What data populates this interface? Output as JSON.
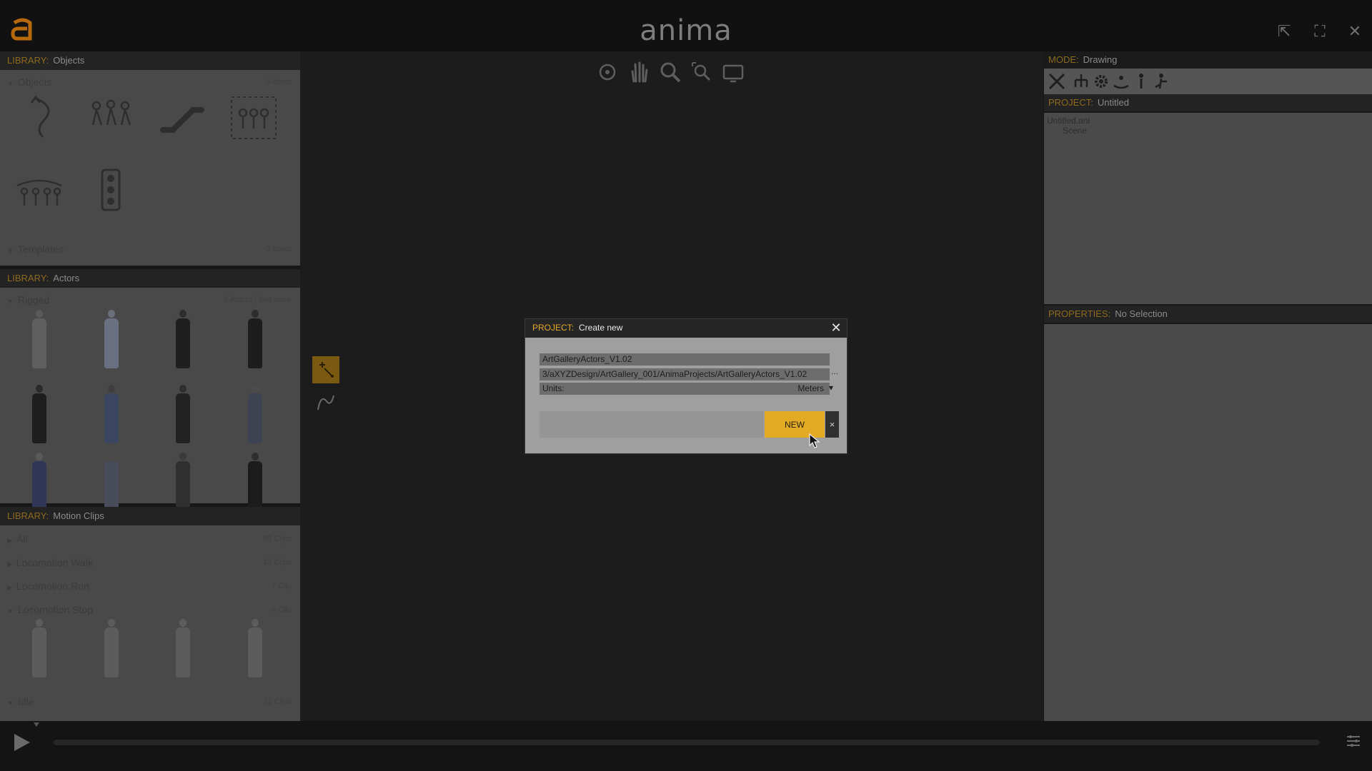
{
  "app": {
    "brand": "anima"
  },
  "colors": {
    "accent": "#e3aa23",
    "panel": "#494949",
    "header": "#232323",
    "viewport": "#1c1c1c"
  },
  "library_objects": {
    "key": "LIBRARY:",
    "title": "Objects",
    "sections": [
      {
        "label": "Objects",
        "count": "6 Items"
      },
      {
        "label": "Templates",
        "count": "0 Items"
      }
    ],
    "icons": [
      "path-icon",
      "crowd-walk-icon",
      "escalator-icon",
      "group-area-icon",
      "queue-icon",
      "traffic-light-icon"
    ]
  },
  "library_actors": {
    "key": "LIBRARY:",
    "title": "Actors",
    "sections": [
      {
        "label": "Rigged",
        "count": "0 Actors | Get more"
      }
    ]
  },
  "library_motion": {
    "key": "LIBRARY:",
    "title": "Motion Clips",
    "sections": [
      {
        "label": "All",
        "count": "53 Clips"
      },
      {
        "label": "Locomotion Walk",
        "count": "13 Clips"
      },
      {
        "label": "Locomotion Run",
        "count": "7 Clip"
      },
      {
        "label": "Locomotion Stop",
        "count": "4 Clip"
      },
      {
        "label": "Idle",
        "count": "11 Clips"
      }
    ]
  },
  "viewport_tools": [
    "orbit-icon",
    "pan-hand-icon",
    "zoom-icon",
    "zoom-extents-icon",
    "camera-view-icon"
  ],
  "left_tools": [
    "add-point-icon",
    "curve-path-icon"
  ],
  "mode": {
    "key": "MODE:",
    "value": "Drawing",
    "tools": [
      "draw-path-icon",
      "hierarchy-icon",
      "settings-gear-icon",
      "floor-icon",
      "actor-stand-icon",
      "actor-walk-icon"
    ]
  },
  "project": {
    "key": "PROJECT:",
    "value": "Untitled",
    "tree": [
      {
        "label": "Untitled.ani"
      },
      {
        "label": "Scene"
      }
    ]
  },
  "properties": {
    "key": "PROPERTIES:",
    "value": "No Selection"
  },
  "modal": {
    "key": "PROJECT:",
    "title": "Create new",
    "name_value": "ArtGalleryActors_V1.02",
    "path_value": "3/aXYZDesign/ArtGallery_001/AnimaProjects/ArtGalleryActors_V1.02",
    "units_label": "Units:",
    "units_value": "Meters",
    "new_label": "NEW",
    "cancel_label": "×",
    "browse_label": "···",
    "dropdown_label": "▾"
  },
  "window_controls": [
    "popout-icon",
    "fullscreen-icon",
    "close-icon"
  ]
}
